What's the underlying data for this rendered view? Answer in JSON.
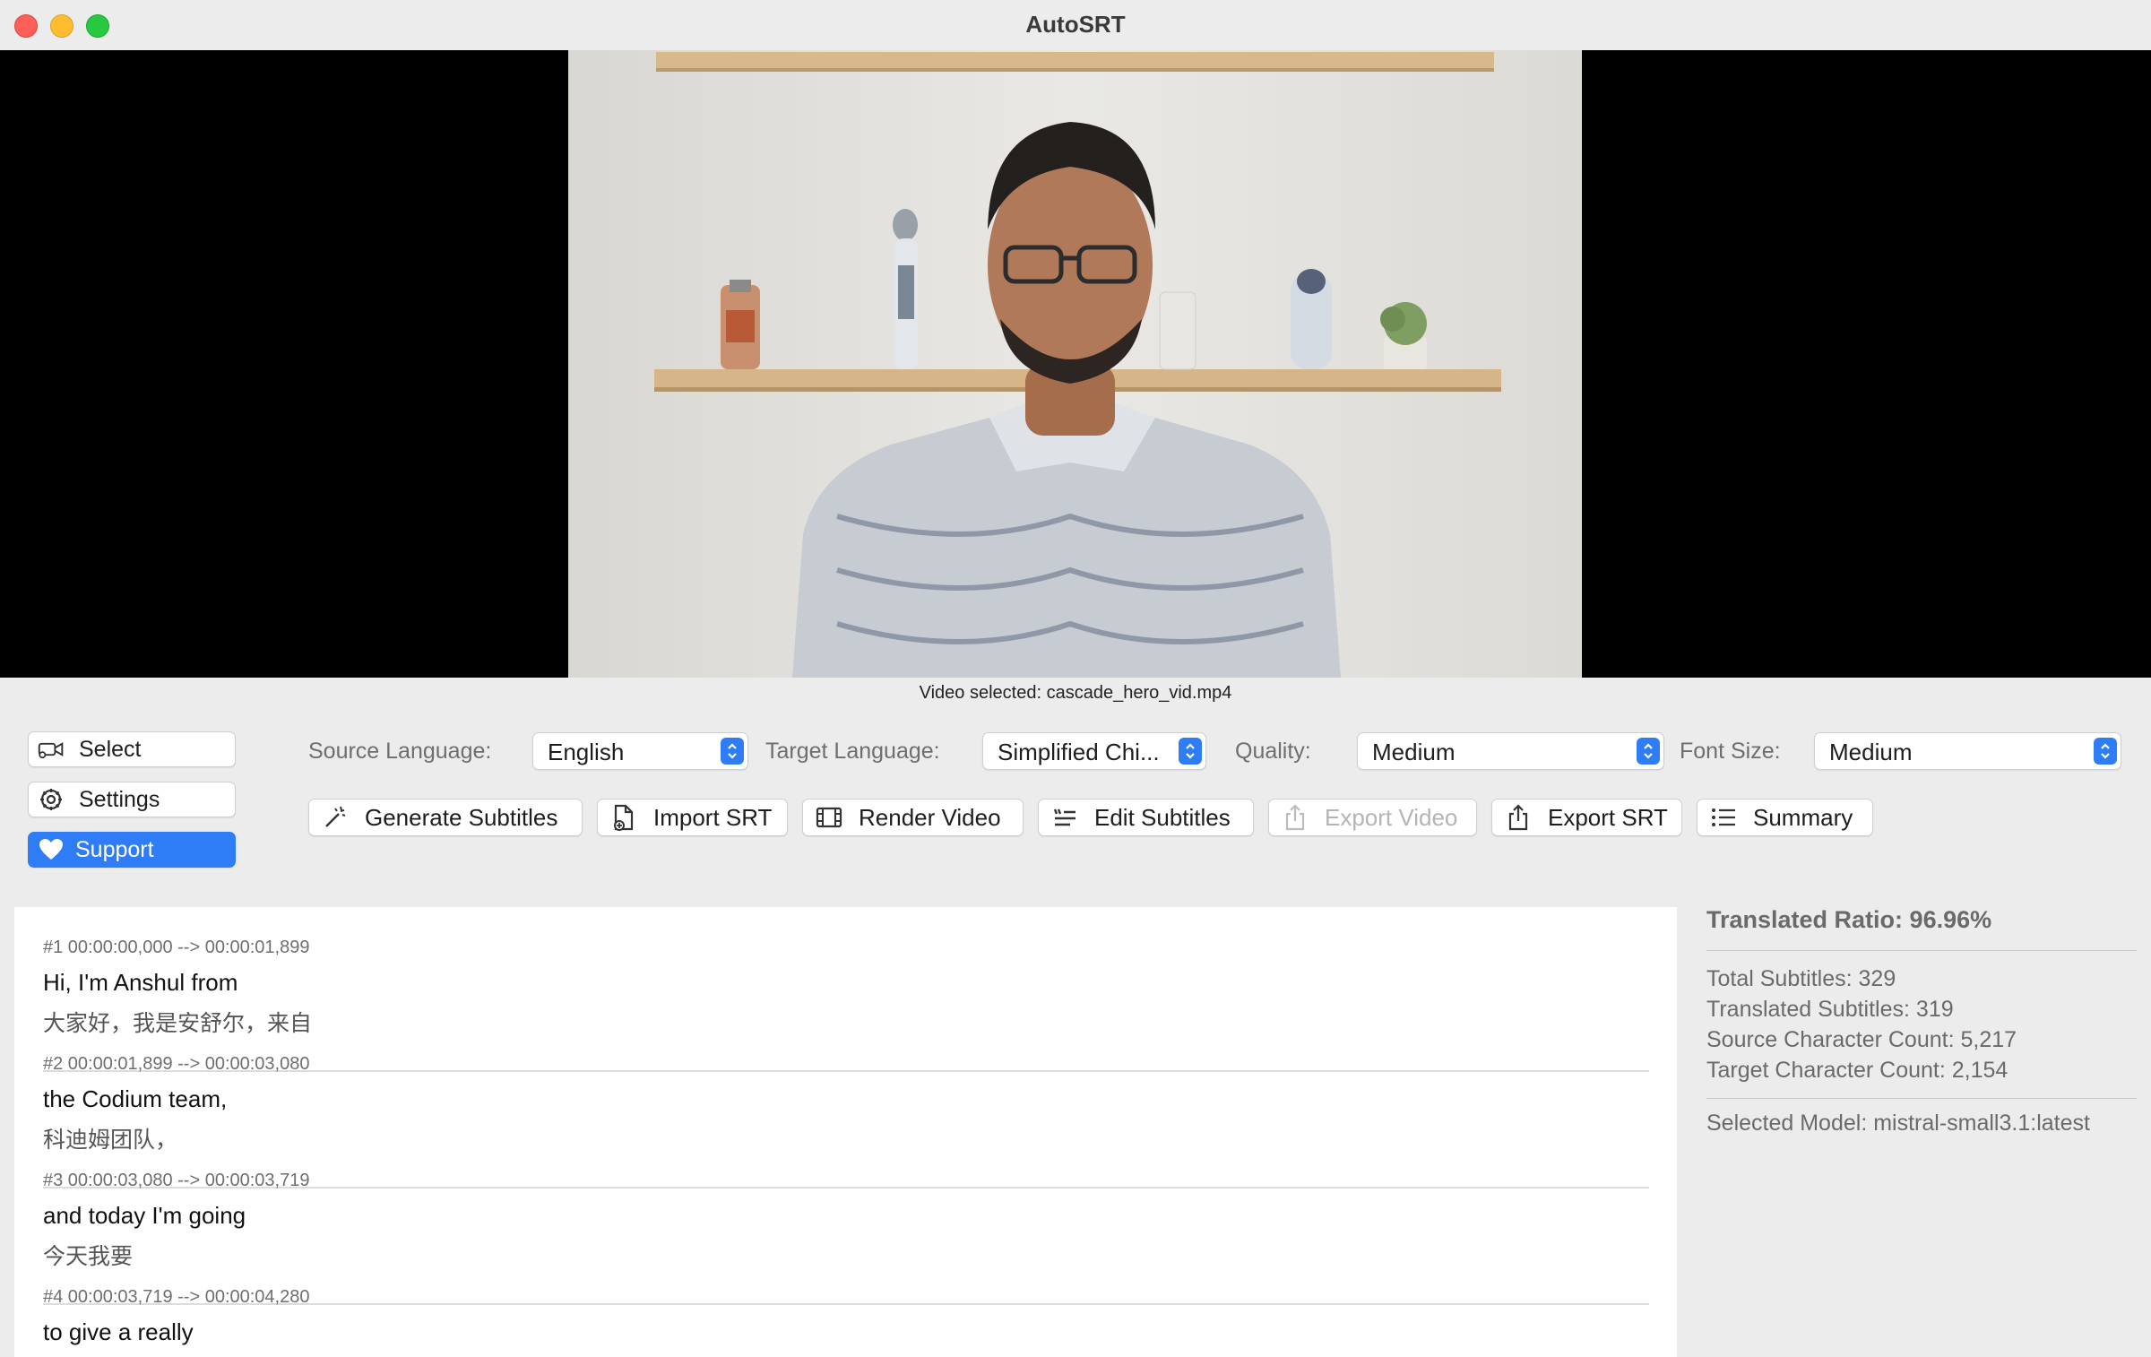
{
  "window": {
    "title": "AutoSRT"
  },
  "video": {
    "caption": "Video selected: cascade_hero_vid.mp4"
  },
  "sidebar": {
    "select": "Select",
    "settings": "Settings",
    "support": "Support"
  },
  "options": {
    "source_label": "Source Language:",
    "source_value": "English",
    "target_label": "Target Language:",
    "target_value": "Simplified Chi...",
    "quality_label": "Quality:",
    "quality_value": "Medium",
    "fontsize_label": "Font Size:",
    "fontsize_value": "Medium"
  },
  "toolbar": {
    "generate": "Generate Subtitles",
    "import": "Import SRT",
    "render": "Render Video",
    "edit": "Edit Subtitles",
    "export_video": "Export Video",
    "export_srt": "Export SRT",
    "summary": "Summary"
  },
  "subtitles": [
    {
      "header": "#1 00:00:00,000 --> 00:00:01,899",
      "source": "Hi, I'm Anshul from",
      "target": "大家好，我是安舒尔，来自"
    },
    {
      "header": "#2 00:00:01,899 --> 00:00:03,080",
      "source": "the Codium team,",
      "target": "科迪姆团队，"
    },
    {
      "header": "#3 00:00:03,080 --> 00:00:03,719",
      "source": "and today I'm going",
      "target": "今天我要"
    },
    {
      "header": "#4 00:00:03,719 --> 00:00:04,280",
      "source": "to give a really",
      "target": ""
    }
  ],
  "stats": {
    "ratio": "Translated Ratio: 96.96%",
    "total": "Total Subtitles: 329",
    "translated": "Translated Subtitles: 319",
    "source_chars": "Source Character Count: 5,217",
    "target_chars": "Target Character Count: 2,154",
    "model": "Selected Model: mistral-small3.1:latest"
  },
  "colors": {
    "accent": "#2f7df6",
    "close": "#ff5f57",
    "minimize": "#febc2e",
    "maximize": "#28c840"
  }
}
